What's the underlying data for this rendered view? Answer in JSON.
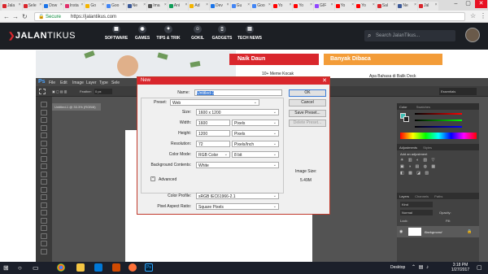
{
  "browser": {
    "tabs": [
      {
        "label": "Jala",
        "color": "#d9262c"
      },
      {
        "label": "Sele",
        "color": "#d9262c"
      },
      {
        "label": "Dow",
        "color": "#1a73e8"
      },
      {
        "label": "Insta",
        "color": "#e1306c"
      },
      {
        "label": "Go",
        "color": "#f4b400"
      },
      {
        "label": "Goo",
        "color": "#4285f4"
      },
      {
        "label": "Ne",
        "color": "#3b5998"
      },
      {
        "label": "Ima",
        "color": "#555555"
      },
      {
        "label": "Ani",
        "color": "#0f9d58"
      },
      {
        "label": "Ad",
        "color": "#f4b400"
      },
      {
        "label": "Dev",
        "color": "#1a73e8"
      },
      {
        "label": "Gu",
        "color": "#4285f4"
      },
      {
        "label": "Goo",
        "color": "#4285f4"
      },
      {
        "label": "Yo",
        "color": "#ff0000"
      },
      {
        "label": "Yo",
        "color": "#ff0000"
      },
      {
        "label": "GIF",
        "color": "#9146ff"
      },
      {
        "label": "Yo",
        "color": "#ff0000"
      },
      {
        "label": "Yo",
        "color": "#ff0000"
      },
      {
        "label": "Sal",
        "color": "#d9262c"
      },
      {
        "label": "Ne",
        "color": "#3b5998"
      },
      {
        "label": "Jal",
        "color": "#d9262c"
      }
    ],
    "secure_label": "Secure",
    "url": "https://jalantikus.com"
  },
  "site": {
    "logo_a": "JALAN",
    "logo_b": "TIKUS",
    "nav": [
      {
        "label": "SOFTWARE",
        "icon": "grid-icon"
      },
      {
        "label": "GAMES",
        "icon": "gamepad-icon"
      },
      {
        "label": "TIPS & TRIK",
        "icon": "bulb-icon"
      },
      {
        "label": "GOKIL",
        "icon": "smile-icon"
      },
      {
        "label": "GADGETS",
        "icon": "phone-icon"
      },
      {
        "label": "TECH NEWS",
        "icon": "news-icon"
      }
    ],
    "search_placeholder": "Search JalanTikus...",
    "naik_daun": "Naik Daun",
    "banyak_dibaca": "Banyak Dibaca",
    "article1": "10+ Meme Kocak",
    "article2": "Apa Bahasa di Balik Dock"
  },
  "photoshop": {
    "menu": [
      "File",
      "Edit",
      "Image",
      "Layer",
      "Type",
      "Sele"
    ],
    "app_icon": "Ps",
    "feather_label": "Feather:",
    "feather_value": "0 px",
    "essentials": "Essentials",
    "doc_tab": "Untitled-1 @ 33.3% (RGB/8)",
    "color_tab": "Color",
    "swatches_tab": "Swatches",
    "adjustments_tab": "Adjustments",
    "styles_tab": "Styles",
    "add_adjustment": "Add an adjustment",
    "layers_tab": "Layers",
    "channels_tab": "Channels",
    "paths_tab": "Paths",
    "kind_label": "Kind",
    "normal_label": "Normal",
    "opacity_label": "Opacity:",
    "fill_label": "Fill:",
    "lock_label": "Lock:",
    "layer_name": "Background"
  },
  "dialog": {
    "title": "New",
    "name_label": "Name:",
    "name_value": "Untitled-1",
    "preset_label": "Preset:",
    "preset_value": "Web",
    "size_label": "Size:",
    "size_value": "1600 x 1200",
    "width_label": "Width:",
    "width_value": "1600",
    "width_unit": "Pixels",
    "height_label": "Height:",
    "height_value": "1200",
    "height_unit": "Pixels",
    "resolution_label": "Resolution:",
    "resolution_value": "72",
    "resolution_unit": "Pixels/Inch",
    "color_mode_label": "Color Mode:",
    "color_mode_value": "RGB Color",
    "bit_depth": "8 bit",
    "background_label": "Background Contents:",
    "background_value": "White",
    "advanced_label": "Advanced",
    "profile_label": "Color Profile:",
    "profile_value": "sRGB IEC61966-2.1",
    "aspect_label": "Pixel Aspect Ratio:",
    "aspect_value": "Square Pixels",
    "ok_button": "OK",
    "cancel_button": "Cancel",
    "save_preset_button": "Save Preset...",
    "delete_preset_button": "Delete Preset...",
    "image_size_label": "Image Size:",
    "image_size_value": "5.49M"
  },
  "taskbar": {
    "desktop_label": "Desktop",
    "time": "3:18 PM",
    "date": "1/27/2017"
  }
}
